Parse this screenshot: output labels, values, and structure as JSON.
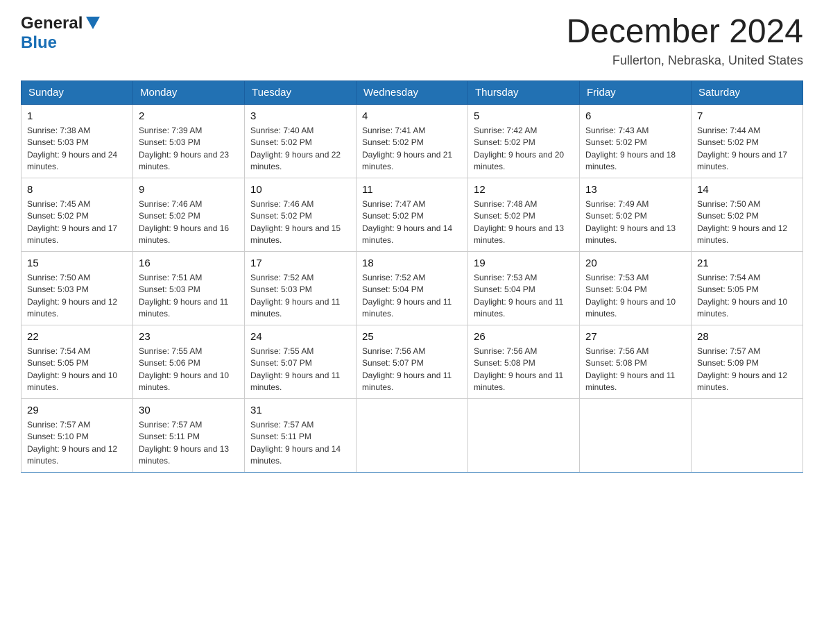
{
  "header": {
    "logo_general": "General",
    "logo_arrow": "▼",
    "logo_blue": "Blue",
    "month_title": "December 2024",
    "location": "Fullerton, Nebraska, United States"
  },
  "weekdays": [
    "Sunday",
    "Monday",
    "Tuesday",
    "Wednesday",
    "Thursday",
    "Friday",
    "Saturday"
  ],
  "weeks": [
    [
      {
        "day": "1",
        "sunrise": "7:38 AM",
        "sunset": "5:03 PM",
        "daylight": "9 hours and 24 minutes."
      },
      {
        "day": "2",
        "sunrise": "7:39 AM",
        "sunset": "5:03 PM",
        "daylight": "9 hours and 23 minutes."
      },
      {
        "day": "3",
        "sunrise": "7:40 AM",
        "sunset": "5:02 PM",
        "daylight": "9 hours and 22 minutes."
      },
      {
        "day": "4",
        "sunrise": "7:41 AM",
        "sunset": "5:02 PM",
        "daylight": "9 hours and 21 minutes."
      },
      {
        "day": "5",
        "sunrise": "7:42 AM",
        "sunset": "5:02 PM",
        "daylight": "9 hours and 20 minutes."
      },
      {
        "day": "6",
        "sunrise": "7:43 AM",
        "sunset": "5:02 PM",
        "daylight": "9 hours and 18 minutes."
      },
      {
        "day": "7",
        "sunrise": "7:44 AM",
        "sunset": "5:02 PM",
        "daylight": "9 hours and 17 minutes."
      }
    ],
    [
      {
        "day": "8",
        "sunrise": "7:45 AM",
        "sunset": "5:02 PM",
        "daylight": "9 hours and 17 minutes."
      },
      {
        "day": "9",
        "sunrise": "7:46 AM",
        "sunset": "5:02 PM",
        "daylight": "9 hours and 16 minutes."
      },
      {
        "day": "10",
        "sunrise": "7:46 AM",
        "sunset": "5:02 PM",
        "daylight": "9 hours and 15 minutes."
      },
      {
        "day": "11",
        "sunrise": "7:47 AM",
        "sunset": "5:02 PM",
        "daylight": "9 hours and 14 minutes."
      },
      {
        "day": "12",
        "sunrise": "7:48 AM",
        "sunset": "5:02 PM",
        "daylight": "9 hours and 13 minutes."
      },
      {
        "day": "13",
        "sunrise": "7:49 AM",
        "sunset": "5:02 PM",
        "daylight": "9 hours and 13 minutes."
      },
      {
        "day": "14",
        "sunrise": "7:50 AM",
        "sunset": "5:02 PM",
        "daylight": "9 hours and 12 minutes."
      }
    ],
    [
      {
        "day": "15",
        "sunrise": "7:50 AM",
        "sunset": "5:03 PM",
        "daylight": "9 hours and 12 minutes."
      },
      {
        "day": "16",
        "sunrise": "7:51 AM",
        "sunset": "5:03 PM",
        "daylight": "9 hours and 11 minutes."
      },
      {
        "day": "17",
        "sunrise": "7:52 AM",
        "sunset": "5:03 PM",
        "daylight": "9 hours and 11 minutes."
      },
      {
        "day": "18",
        "sunrise": "7:52 AM",
        "sunset": "5:04 PM",
        "daylight": "9 hours and 11 minutes."
      },
      {
        "day": "19",
        "sunrise": "7:53 AM",
        "sunset": "5:04 PM",
        "daylight": "9 hours and 11 minutes."
      },
      {
        "day": "20",
        "sunrise": "7:53 AM",
        "sunset": "5:04 PM",
        "daylight": "9 hours and 10 minutes."
      },
      {
        "day": "21",
        "sunrise": "7:54 AM",
        "sunset": "5:05 PM",
        "daylight": "9 hours and 10 minutes."
      }
    ],
    [
      {
        "day": "22",
        "sunrise": "7:54 AM",
        "sunset": "5:05 PM",
        "daylight": "9 hours and 10 minutes."
      },
      {
        "day": "23",
        "sunrise": "7:55 AM",
        "sunset": "5:06 PM",
        "daylight": "9 hours and 10 minutes."
      },
      {
        "day": "24",
        "sunrise": "7:55 AM",
        "sunset": "5:07 PM",
        "daylight": "9 hours and 11 minutes."
      },
      {
        "day": "25",
        "sunrise": "7:56 AM",
        "sunset": "5:07 PM",
        "daylight": "9 hours and 11 minutes."
      },
      {
        "day": "26",
        "sunrise": "7:56 AM",
        "sunset": "5:08 PM",
        "daylight": "9 hours and 11 minutes."
      },
      {
        "day": "27",
        "sunrise": "7:56 AM",
        "sunset": "5:08 PM",
        "daylight": "9 hours and 11 minutes."
      },
      {
        "day": "28",
        "sunrise": "7:57 AM",
        "sunset": "5:09 PM",
        "daylight": "9 hours and 12 minutes."
      }
    ],
    [
      {
        "day": "29",
        "sunrise": "7:57 AM",
        "sunset": "5:10 PM",
        "daylight": "9 hours and 12 minutes."
      },
      {
        "day": "30",
        "sunrise": "7:57 AM",
        "sunset": "5:11 PM",
        "daylight": "9 hours and 13 minutes."
      },
      {
        "day": "31",
        "sunrise": "7:57 AM",
        "sunset": "5:11 PM",
        "daylight": "9 hours and 14 minutes."
      },
      null,
      null,
      null,
      null
    ]
  ]
}
